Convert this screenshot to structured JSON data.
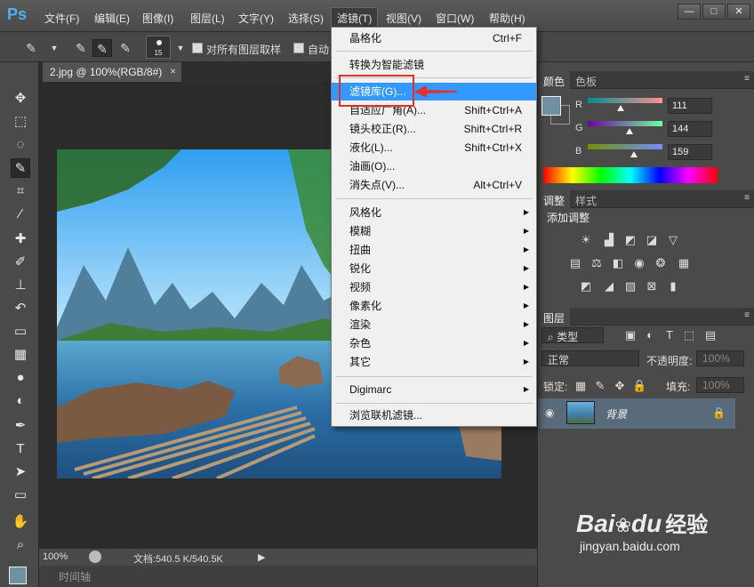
{
  "app": {
    "logo": "Ps"
  },
  "menubar": {
    "items": [
      "文件(F)",
      "编辑(E)",
      "图像(I)",
      "图层(L)",
      "文字(Y)",
      "选择(S)",
      "滤镜(T)",
      "视图(V)",
      "窗口(W)",
      "帮助(H)"
    ],
    "window_controls": [
      "—",
      "□",
      "✕"
    ]
  },
  "options_bar": {
    "brush_size": "15",
    "sample_all_label": "对所有图层取样",
    "auto_label": "自动"
  },
  "document": {
    "tab_title": "2.jpg @ 100%(RGB/8#)",
    "tab_close": "×",
    "zoom": "100%",
    "doc_info": "文档:540.5 K/540.5K",
    "timeline_label": "时间轴"
  },
  "filter_menu": {
    "items": [
      {
        "label": "晶格化",
        "shortcut": "Ctrl+F"
      },
      {
        "label": "转换为智能滤镜",
        "shortcut": ""
      },
      {
        "label": "滤镜库(G)...",
        "shortcut": "",
        "highlighted": true
      },
      {
        "label": "自适应广角(A)...",
        "shortcut": "Shift+Ctrl+A"
      },
      {
        "label": "镜头校正(R)...",
        "shortcut": "Shift+Ctrl+R"
      },
      {
        "label": "液化(L)...",
        "shortcut": "Shift+Ctrl+X"
      },
      {
        "label": "油画(O)...",
        "shortcut": ""
      },
      {
        "label": "消失点(V)...",
        "shortcut": "Alt+Ctrl+V"
      },
      {
        "label": "风格化",
        "submenu": true
      },
      {
        "label": "模糊",
        "submenu": true
      },
      {
        "label": "扭曲",
        "submenu": true
      },
      {
        "label": "锐化",
        "submenu": true
      },
      {
        "label": "视频",
        "submenu": true
      },
      {
        "label": "像素化",
        "submenu": true
      },
      {
        "label": "渲染",
        "submenu": true
      },
      {
        "label": "杂色",
        "submenu": true
      },
      {
        "label": "其它",
        "submenu": true
      },
      {
        "label": "Digimarc",
        "submenu": true
      },
      {
        "label": "浏览联机滤镜...",
        "shortcut": ""
      }
    ]
  },
  "color_panel": {
    "tabs": [
      "颜色",
      "色板"
    ],
    "channels": [
      {
        "name": "R",
        "value": "111",
        "fraction": 0.435
      },
      {
        "name": "G",
        "value": "144",
        "fraction": 0.565
      },
      {
        "name": "B",
        "value": "159",
        "fraction": 0.624
      }
    ],
    "foreground_color": "#6f90a0"
  },
  "adjustments_panel": {
    "tabs": [
      "调整",
      "样式"
    ],
    "title": "添加调整"
  },
  "layers_panel": {
    "tabs": [
      "图层"
    ],
    "filter_kind": "类型",
    "blend_mode": "正常",
    "opacity_label": "不透明度:",
    "opacity_value": "100%",
    "lock_label": "锁定:",
    "fill_label": "填充:",
    "fill_value": "100%",
    "layer_name": "背景"
  },
  "watermark": {
    "brand": "Bai",
    "brand2": "du",
    "brand3": "经验",
    "url": "jingyan.baidu.com"
  }
}
